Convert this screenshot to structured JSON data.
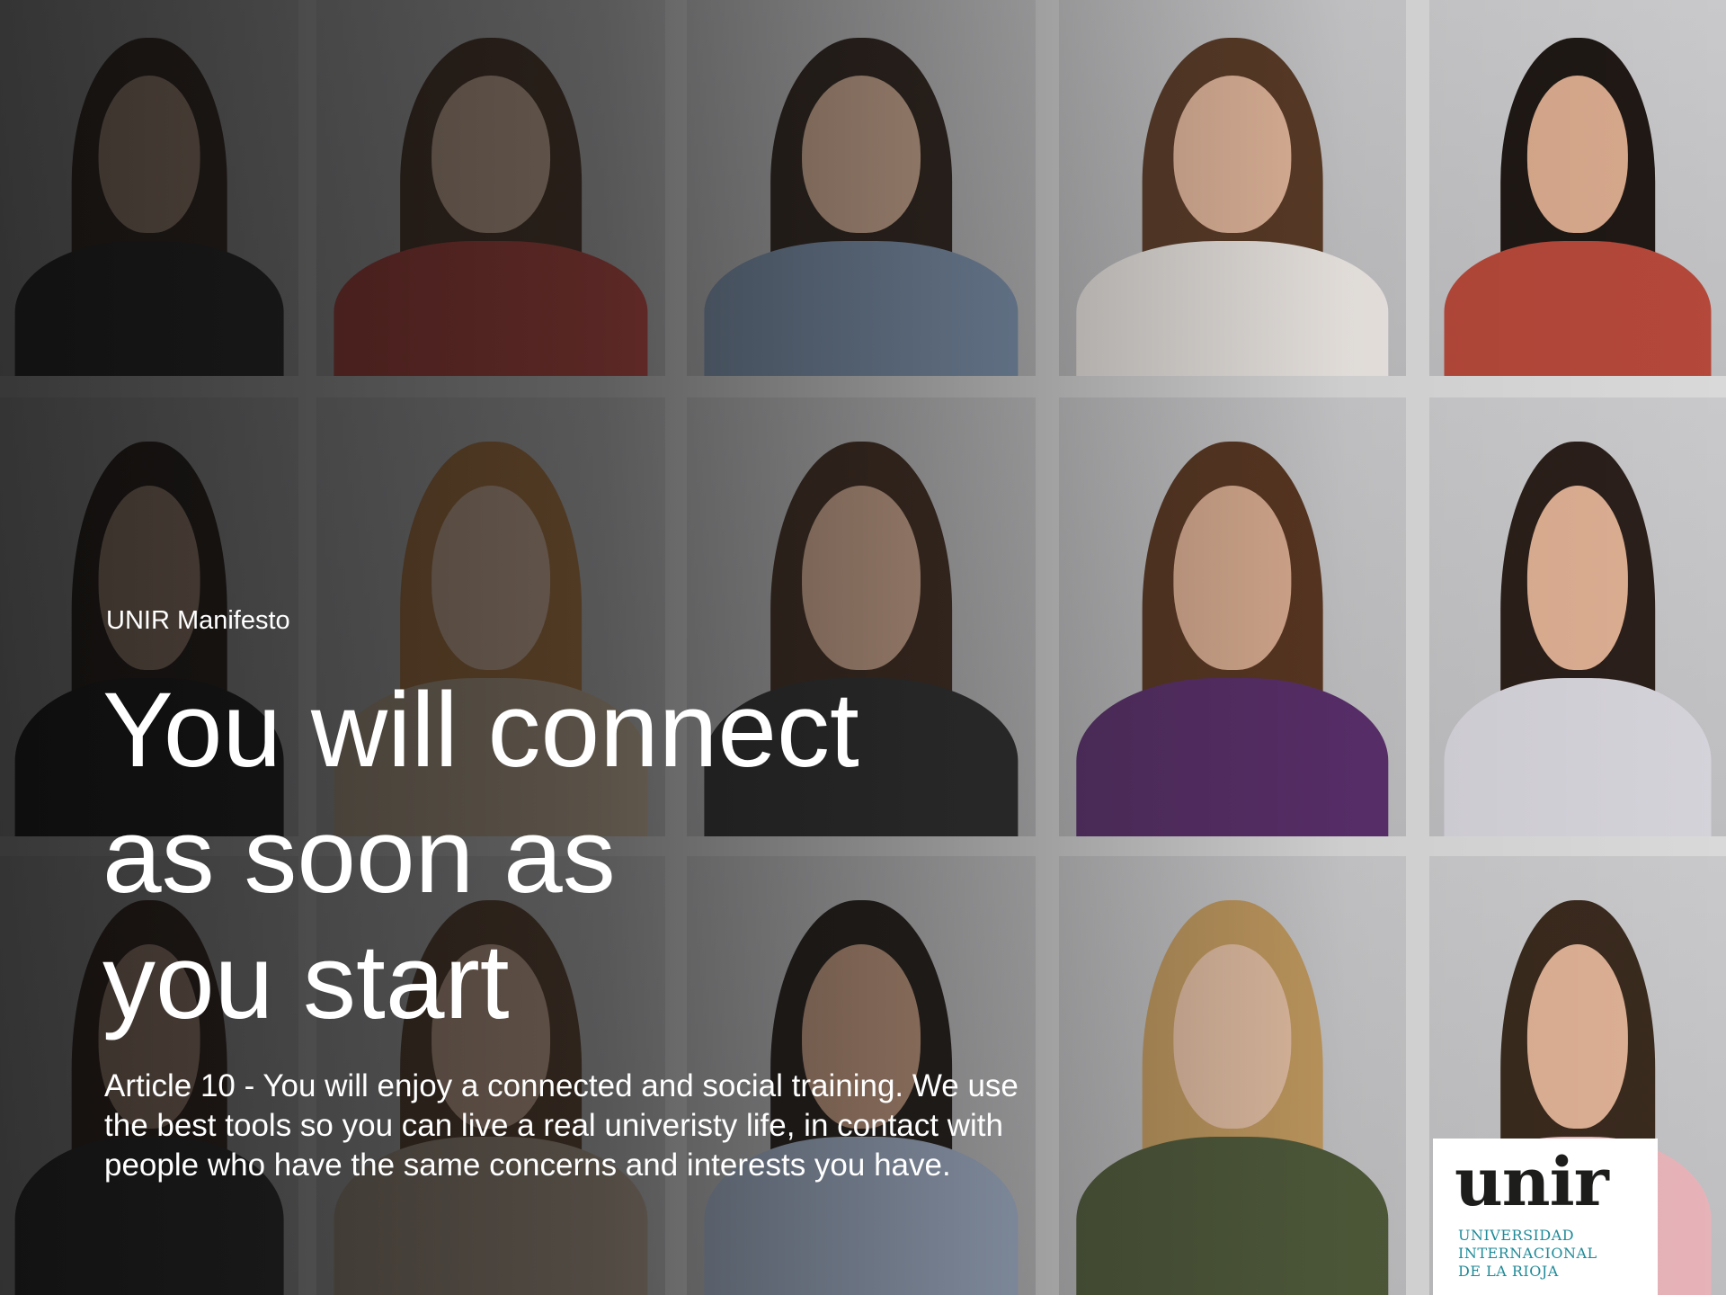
{
  "manifesto": {
    "kicker": "UNIR Manifesto",
    "headline_lines": [
      "You will connect",
      "as soon as",
      "you start"
    ],
    "article_text": "Article 10 - You will enjoy a connected and social training. We use the best tools so you can live a real univeristy life, in contact with people who have the same concerns and interests you have."
  },
  "logo": {
    "wordmark": "unir",
    "lines": [
      "UNIVERSIDAD",
      "INTERNACIONAL",
      "DE LA RIOJA"
    ],
    "accent_color": "#1f8a98"
  },
  "photo_grid": {
    "columns": 5,
    "rows": 3,
    "photos": [
      {
        "name": "portrait-woman-dark-blazer",
        "shirt": "#2b2b2b",
        "hair": "#3a2a20",
        "skin": "#d8b49a"
      },
      {
        "name": "portrait-woman-red-top",
        "shirt": "#c8453e",
        "hair": "#4a3122",
        "skin": "#e2bfa5"
      },
      {
        "name": "portrait-man-glasses-blue-shirt",
        "shirt": "#7f96b3",
        "hair": "#2a1e17",
        "skin": "#d9b196"
      },
      {
        "name": "portrait-woman-white-tshirt",
        "shirt": "#ece7e3",
        "hair": "#5b3b26",
        "skin": "#e4b79c"
      },
      {
        "name": "portrait-woman-patterned-top",
        "shirt": "#b4483a",
        "hair": "#1f1814",
        "skin": "#d7a88c"
      },
      {
        "name": "portrait-woman-black-top",
        "shirt": "#1c1c1c",
        "hair": "#2a1f19",
        "skin": "#d0ab92"
      },
      {
        "name": "portrait-woman-glasses-blazer",
        "shirt": "#cbb59a",
        "hair": "#b77a3e",
        "skin": "#e6c1a6"
      },
      {
        "name": "portrait-woman-floral-top",
        "shirt": "#2c2c2c",
        "hair": "#3c271b",
        "skin": "#d8ad92"
      },
      {
        "name": "portrait-woman-purple-tshirt",
        "shirt": "#5a2f6b",
        "hair": "#5a3722",
        "skin": "#dcae92"
      },
      {
        "name": "portrait-man-striped-polo",
        "shirt": "#d5d3da",
        "hair": "#2b1f1a",
        "skin": "#dcae92"
      },
      {
        "name": "portrait-woman-dark-jacket",
        "shirt": "#2f2f2f",
        "hair": "#3a281d",
        "skin": "#d6ae95"
      },
      {
        "name": "portrait-woman-light-top",
        "shirt": "#b5a28f",
        "hair": "#5a3f2a",
        "skin": "#dcb59b"
      },
      {
        "name": "portrait-man-light-blue-shirt",
        "shirt": "#a9b9d3",
        "hair": "#1e1814",
        "skin": "#c99c80"
      },
      {
        "name": "portrait-woman-green-top",
        "shirt": "#4f5a3a",
        "hair": "#c29a5f",
        "skin": "#e3bea3"
      },
      {
        "name": "portrait-man-pink-shirt",
        "shirt": "#e7b3b9",
        "hair": "#3a2a1e",
        "skin": "#ddb094"
      }
    ]
  }
}
